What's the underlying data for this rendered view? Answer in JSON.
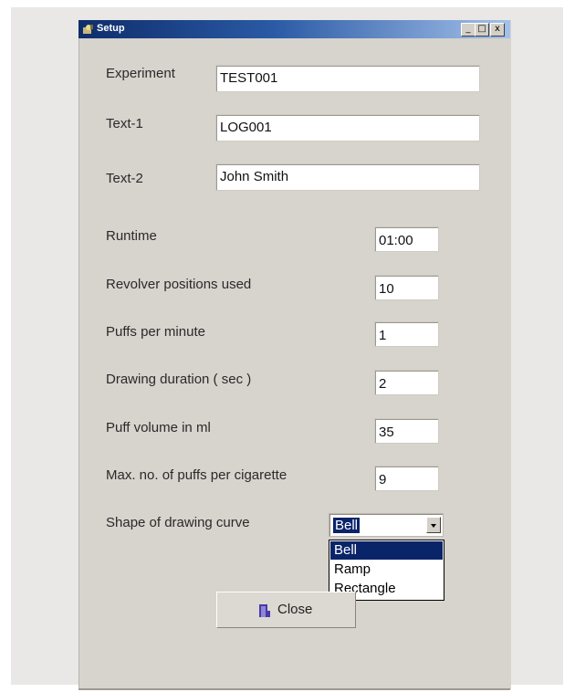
{
  "window": {
    "title": "Setup",
    "controls": {
      "minimize": "_",
      "maximize": "□",
      "close": "x"
    }
  },
  "fields": {
    "experiment": {
      "label": "Experiment",
      "value": "TEST001"
    },
    "text1": {
      "label": "Text-1",
      "value": "LOG001"
    },
    "text2": {
      "label": "Text-2",
      "value": "John Smith"
    },
    "runtime": {
      "label": "Runtime",
      "value": "01:00"
    },
    "revolver_positions": {
      "label": "Revolver positions used",
      "value": "10"
    },
    "puffs_per_minute": {
      "label": "Puffs per minute",
      "value": "1"
    },
    "drawing_duration": {
      "label": "Drawing duration ( sec )",
      "value": "2"
    },
    "puff_volume": {
      "label": "Puff volume in ml",
      "value": "35"
    },
    "max_puffs": {
      "label": "Max. no. of puffs per cigarette",
      "value": "9"
    }
  },
  "curve_shape": {
    "label": "Shape of drawing curve",
    "selected": "Bell",
    "options": [
      "Bell",
      "Ramp",
      "Rectangle"
    ]
  },
  "close_button": {
    "label": "Close"
  },
  "colors": {
    "titlebar": "#0e2d6b",
    "selection": "#0a246a",
    "dialog": "#d7d3cd"
  }
}
